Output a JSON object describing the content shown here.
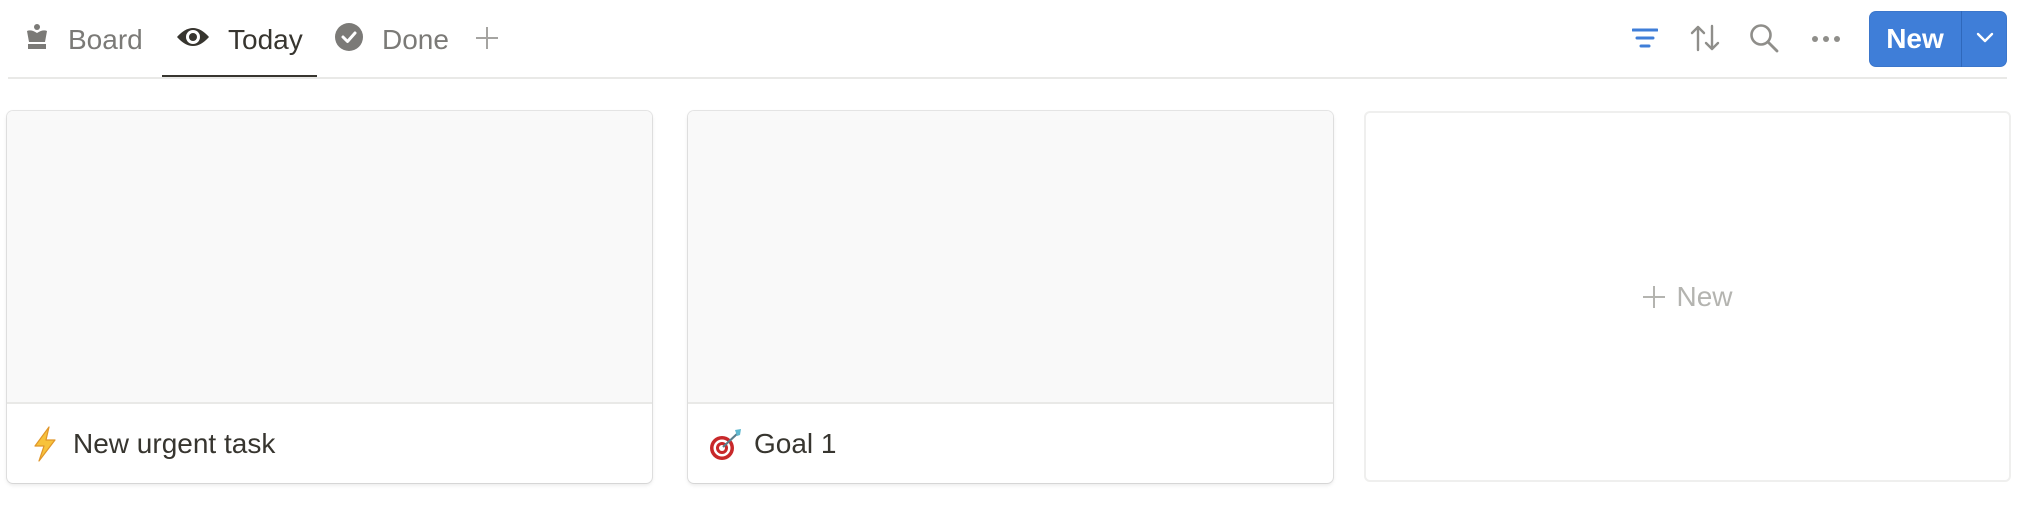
{
  "tabs": [
    {
      "label": "Board",
      "icon": "crown-icon",
      "active": false
    },
    {
      "label": "Today",
      "icon": "eye-icon",
      "active": true
    },
    {
      "label": "Done",
      "icon": "check-circle-icon",
      "active": false
    }
  ],
  "toolbar": {
    "add_view_icon": "plus-icon",
    "filter_icon": "filter-icon",
    "sort_icon": "sort-icon",
    "search_icon": "search-icon",
    "more_icon": "more-icon",
    "new_label": "New",
    "new_menu_icon": "chevron-down-icon"
  },
  "colors": {
    "accent": "#3f7ed8",
    "filter_active": "#3f7ed8",
    "text": "#37352f",
    "muted": "#7b7a77"
  },
  "cards": [
    {
      "title": "New urgent task",
      "emoji": "⚡"
    },
    {
      "title": "Goal 1",
      "emoji": "🎯"
    }
  ],
  "new_card": {
    "label": "New"
  }
}
